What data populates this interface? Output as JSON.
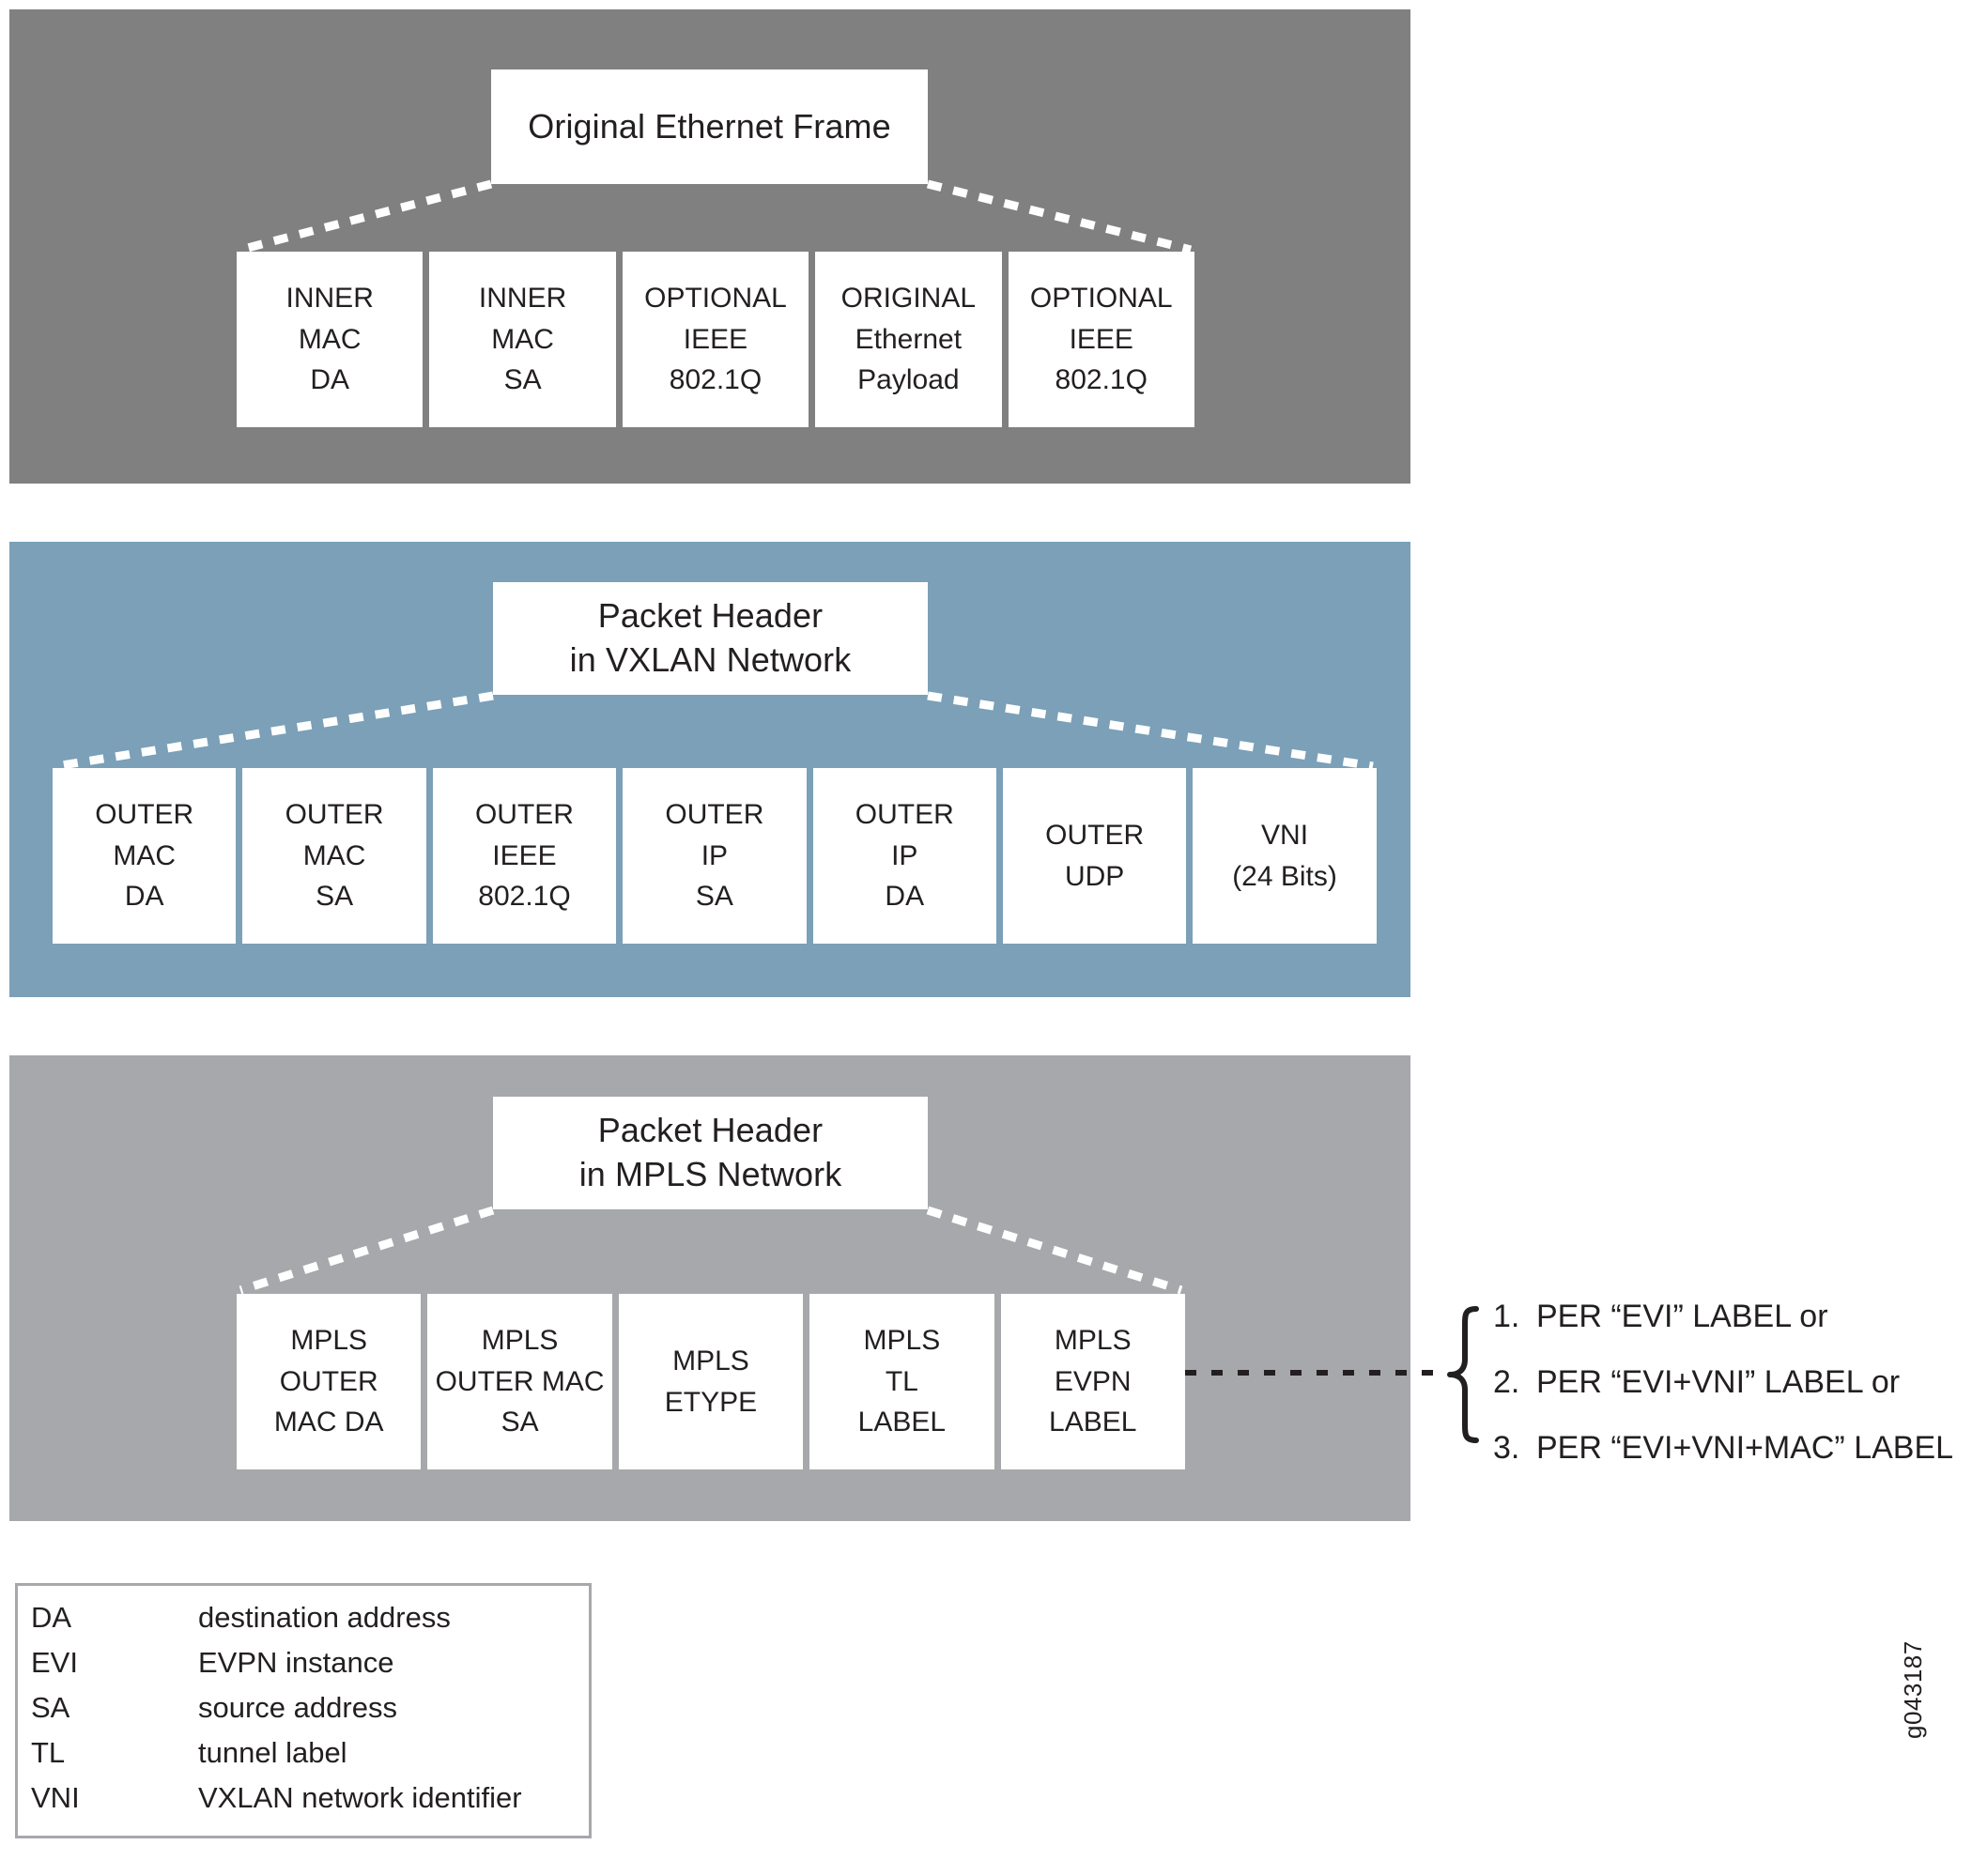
{
  "figure": {
    "watermark": "g043187"
  },
  "sections": [
    {
      "id": "original-ethernet-frame",
      "header": {
        "line1": "Original Ethernet Frame",
        "line2": ""
      },
      "band_color": "#808080",
      "fields": [
        {
          "lines": [
            "INNER",
            "MAC",
            "DA"
          ]
        },
        {
          "lines": [
            "INNER",
            "MAC",
            "SA"
          ]
        },
        {
          "lines": [
            "OPTIONAL",
            "IEEE",
            "802.1Q"
          ]
        },
        {
          "lines": [
            "ORIGINAL",
            "Ethernet",
            "Payload"
          ]
        },
        {
          "lines": [
            "OPTIONAL",
            "IEEE",
            "802.1Q"
          ]
        }
      ]
    },
    {
      "id": "packet-header-vxlan",
      "header": {
        "line1": "Packet Header",
        "line2": "in VXLAN Network"
      },
      "band_color": "#7ba0b8",
      "fields": [
        {
          "lines": [
            "OUTER",
            "MAC",
            "DA"
          ]
        },
        {
          "lines": [
            "OUTER",
            "MAC",
            "SA"
          ]
        },
        {
          "lines": [
            "OUTER",
            "IEEE",
            "802.1Q"
          ]
        },
        {
          "lines": [
            "OUTER",
            "IP",
            "SA"
          ]
        },
        {
          "lines": [
            "OUTER",
            "IP",
            "DA"
          ]
        },
        {
          "lines": [
            "OUTER",
            "UDP"
          ]
        },
        {
          "lines": [
            "VNI",
            "(24 Bits)"
          ]
        }
      ]
    },
    {
      "id": "packet-header-mpls",
      "header": {
        "line1": "Packet Header",
        "line2": "in MPLS Network"
      },
      "band_color": "#a6a8ab",
      "fields": [
        {
          "lines": [
            "MPLS",
            "OUTER",
            "MAC DA"
          ]
        },
        {
          "lines": [
            "MPLS",
            "OUTER MAC",
            "SA"
          ]
        },
        {
          "lines": [
            "MPLS",
            "ETYPE"
          ]
        },
        {
          "lines": [
            "MPLS",
            "TL",
            "LABEL"
          ]
        },
        {
          "lines": [
            "MPLS",
            "EVPN",
            "LABEL"
          ]
        }
      ]
    }
  ],
  "label_options": [
    {
      "num": "1.",
      "text": "PER “EVI” LABEL or"
    },
    {
      "num": "2.",
      "text": "PER “EVI+VNI”  LABEL or"
    },
    {
      "num": "3.",
      "text": "PER “EVI+VNI+MAC” LABEL"
    }
  ],
  "legend": [
    {
      "term": "DA",
      "definition": "destination address"
    },
    {
      "term": "EVI",
      "definition": "EVPN instance"
    },
    {
      "term": "SA",
      "definition": "source address"
    },
    {
      "term": "TL",
      "definition": "tunnel label"
    },
    {
      "term": "VNI",
      "definition": "VXLAN network identifier"
    }
  ]
}
